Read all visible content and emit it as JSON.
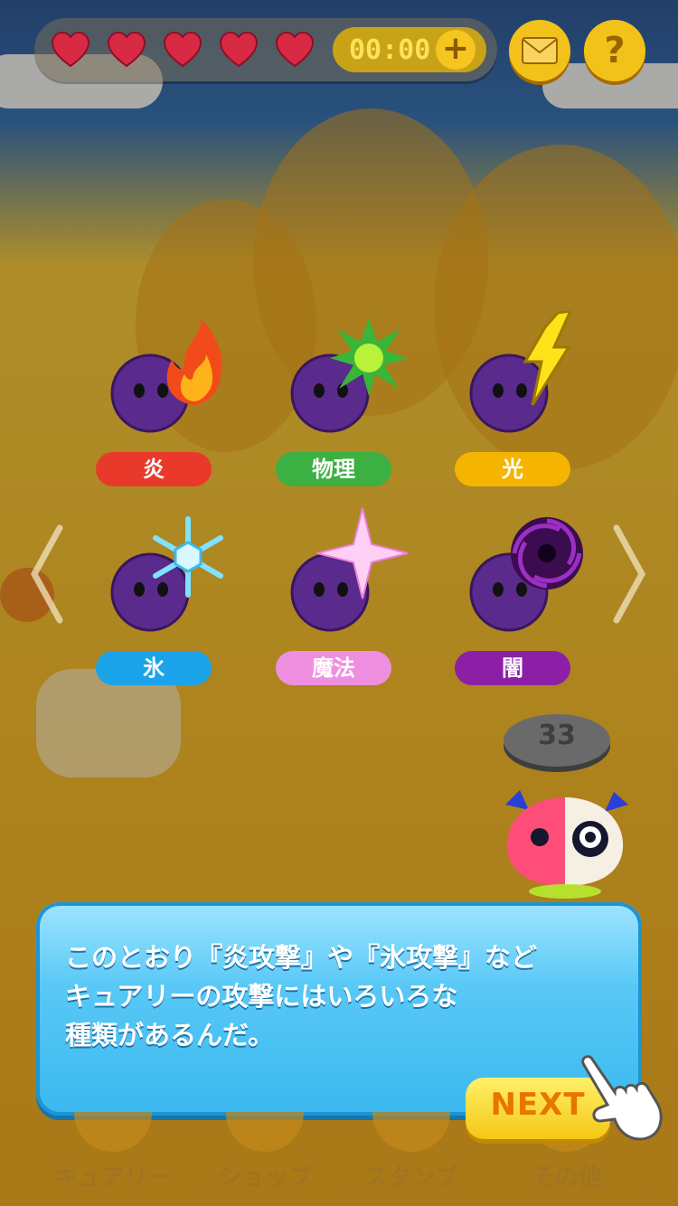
{
  "top_bar": {
    "hearts": [
      "heart",
      "heart",
      "heart",
      "heart",
      "heart"
    ],
    "timer": "00:00",
    "plus_label": "+",
    "mail_icon": "envelope-icon",
    "help_label": "?"
  },
  "attack_types": [
    {
      "label": "炎",
      "color": "#e8392b",
      "icon": "flame-icon"
    },
    {
      "label": "物理",
      "color": "#3cb043",
      "icon": "burst-icon"
    },
    {
      "label": "光",
      "color": "#f5b400",
      "icon": "lightning-icon"
    },
    {
      "label": "氷",
      "color": "#1aa3e8",
      "icon": "snowflake-icon"
    },
    {
      "label": "魔法",
      "color": "#ef8fe0",
      "icon": "sparkle-icon"
    },
    {
      "label": "闇",
      "color": "#8d1fa6",
      "icon": "vortex-icon"
    }
  ],
  "map_level": "33",
  "dialog": {
    "text": "このとおり『炎攻撃』や『氷攻撃』など\nキュアリーの攻撃にはいろいろな\n種類があるんだ。"
  },
  "next_button": "NEXT",
  "bottom_nav": [
    "キュアリー",
    "ショップ",
    "スタンプ",
    "その他"
  ]
}
